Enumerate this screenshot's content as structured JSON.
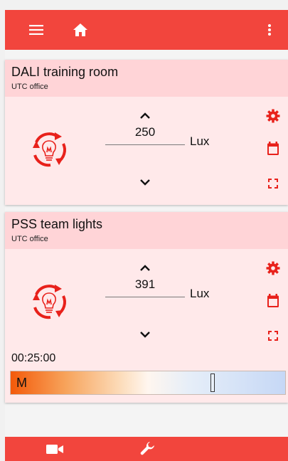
{
  "toolbar": {
    "icons": [
      "menu-icon",
      "home-icon",
      "more-vert-icon"
    ],
    "color": "#f2453d"
  },
  "cards": [
    {
      "title": "DALI training room",
      "subtitle": "UTC office",
      "value": "250",
      "unit": "Lux"
    },
    {
      "title": "PSS team lights",
      "subtitle": "UTC office",
      "value": "391",
      "unit": "Lux",
      "timer": "00:25:00",
      "slider": {
        "mode_label": "M",
        "level": 0.74
      }
    }
  ],
  "bottom_nav": {
    "icons": [
      "video-camera-icon",
      "wrench-icon"
    ]
  },
  "colors": {
    "accent": "#f2453d",
    "card_header": "#ffd4d7",
    "card_body": "#ffe9ea",
    "icon_red": "#e8211b"
  }
}
